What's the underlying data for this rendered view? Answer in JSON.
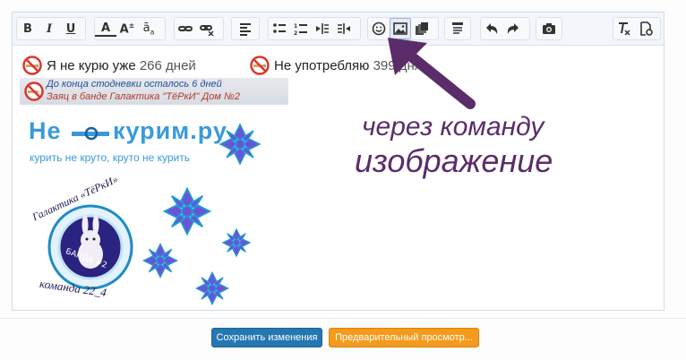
{
  "toolbar": {
    "groups": [
      [
        "bold-icon",
        "italic-icon",
        "underline-icon"
      ],
      [
        "font-color-icon",
        "font-size-icon",
        "font-family-icon"
      ],
      [
        "link-icon",
        "unlink-icon"
      ],
      [
        "align-icon"
      ],
      [
        "bullet-list-icon",
        "numbered-list-icon",
        "outdent-icon",
        "indent-icon"
      ],
      [
        "smiley-icon",
        "image-icon",
        "media-icon"
      ],
      [
        "spoiler-icon"
      ],
      [
        "undo-icon",
        "redo-icon"
      ],
      [
        "camera-icon"
      ],
      [
        "remove-format-icon",
        "toggle-bbcode-icon"
      ]
    ],
    "bold_label": "B",
    "italic_label": "I",
    "underline_label": "U",
    "font_color_label": "A",
    "font_size_label": "A",
    "font_family_label": "a"
  },
  "signature": {
    "line1_prefix": "Я не курю уже",
    "line1_days": "266 дней",
    "line2_prefix": "Не употребляю",
    "line2_days": "399 дня",
    "banner_line1": "До конца стодневки осталось 6 дней",
    "banner_line2": "Заяц в банде Галактика \"ТёРкИ\" Дом №2"
  },
  "logo": {
    "part1": "Не",
    "part2": "курим.ру",
    "slogan": "курить не круто, круто не курить"
  },
  "badge": {
    "arc_top": "Галактика «ТёРкИ»",
    "center": "БАНДА #2",
    "bottom": "команда 22_4"
  },
  "annotation": {
    "line1": "через команду",
    "line2": "изображение"
  },
  "buttons": {
    "save": "Сохранить изменения",
    "preview": "Предварительный просмотр..."
  },
  "colors": {
    "save_button": "#2577b1",
    "preview_button": "#f49a1c",
    "arrow": "#5a2d6a",
    "logo_blue": "#3a9ad9"
  }
}
